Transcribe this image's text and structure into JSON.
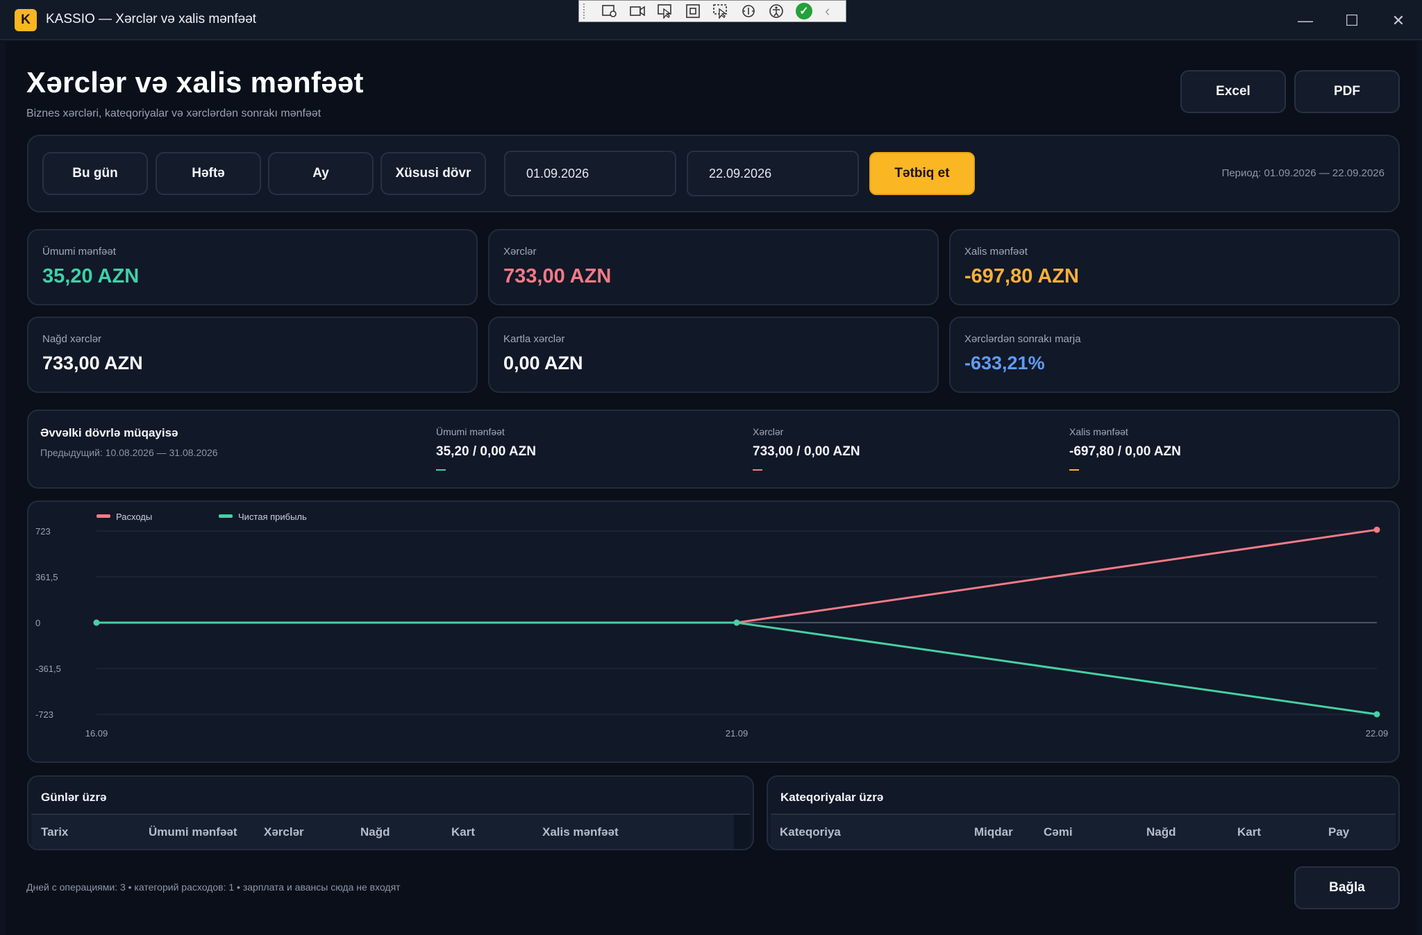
{
  "window": {
    "app_letter": "K",
    "title": "KASSIO — Xərclər və xalis mənfəət",
    "minimize": "—",
    "maximize": "☐",
    "close": "✕"
  },
  "header": {
    "title": "Xərclər və xalis mənfəət",
    "subtitle": "Biznes xərcləri, kateqoriyalar və xərclərdən sonrakı mənfəət",
    "excel_label": "Excel",
    "pdf_label": "PDF"
  },
  "filters": {
    "presets": [
      "Bu gün",
      "Həftə",
      "Ay",
      "Xüsusi dövr"
    ],
    "date_from": "01.09.2026",
    "date_to": "22.09.2026",
    "apply_label": "Tətbiq et",
    "period_text": "Период: 01.09.2026 — 22.09.2026"
  },
  "cards": [
    {
      "label": "Ümumi mənfəət",
      "value": "35,20 AZN",
      "color": "#3ed1a7"
    },
    {
      "label": "Xərclər",
      "value": "733,00 AZN",
      "color": "#f47a86"
    },
    {
      "label": "Xalis mənfəət",
      "value": "-697,80 AZN",
      "color": "#fbb03b"
    },
    {
      "label": "Nağd xərclər",
      "value": "733,00 AZN",
      "color": "#ffffff"
    },
    {
      "label": "Kartla xərclər",
      "value": "0,00 AZN",
      "color": "#ffffff"
    },
    {
      "label": "Xərclərdən sonrakı marja",
      "value": "-633,21%",
      "color": "#5f9cf5"
    }
  ],
  "comparison": {
    "title": "Əvvəlki dövrlə müqayisə",
    "previous": "Предыдущий: 10.08.2026 — 31.08.2026",
    "items": [
      {
        "label": "Ümumi mənfəət",
        "value": "35,20 / 0,00 AZN",
        "color": "#3ed1a7"
      },
      {
        "label": "Xərclər",
        "value": "733,00 / 0,00 AZN",
        "color": "#f47a86"
      },
      {
        "label": "Xalis mənfəət",
        "value": "-697,80 / 0,00 AZN",
        "color": "#fbb03b"
      }
    ]
  },
  "chart_data": {
    "type": "line",
    "x": [
      "16.09",
      "21.09",
      "22.09"
    ],
    "y_ticks": [
      "723",
      "361,5",
      "0",
      "-361,5",
      "-723"
    ],
    "ylim": [
      -723,
      723
    ],
    "grid": true,
    "legend_position": "top-left",
    "series": [
      {
        "name": "Расходы",
        "color": "#f47a86",
        "values": [
          0,
          0,
          733
        ]
      },
      {
        "name": "Чистая прибыль",
        "color": "#48cfa5",
        "values": [
          0,
          0,
          -723
        ]
      }
    ]
  },
  "tables": {
    "days": {
      "title": "Günlər üzrə",
      "columns": [
        "Tarix",
        "Ümumi mənfəət",
        "Xərclər",
        "Nağd",
        "Kart",
        "Xalis mənfəət"
      ]
    },
    "categories": {
      "title": "Kateqoriyalar üzrə",
      "columns": [
        "Kateqoriya",
        "Miqdar",
        "Cəmi",
        "Nağd",
        "Kart",
        "Pay"
      ]
    }
  },
  "footer": {
    "note": "Дней с операциями: 3 • категорий расходов: 1 • зарплата и авансы сюда не входят",
    "close_label": "Bağla"
  }
}
